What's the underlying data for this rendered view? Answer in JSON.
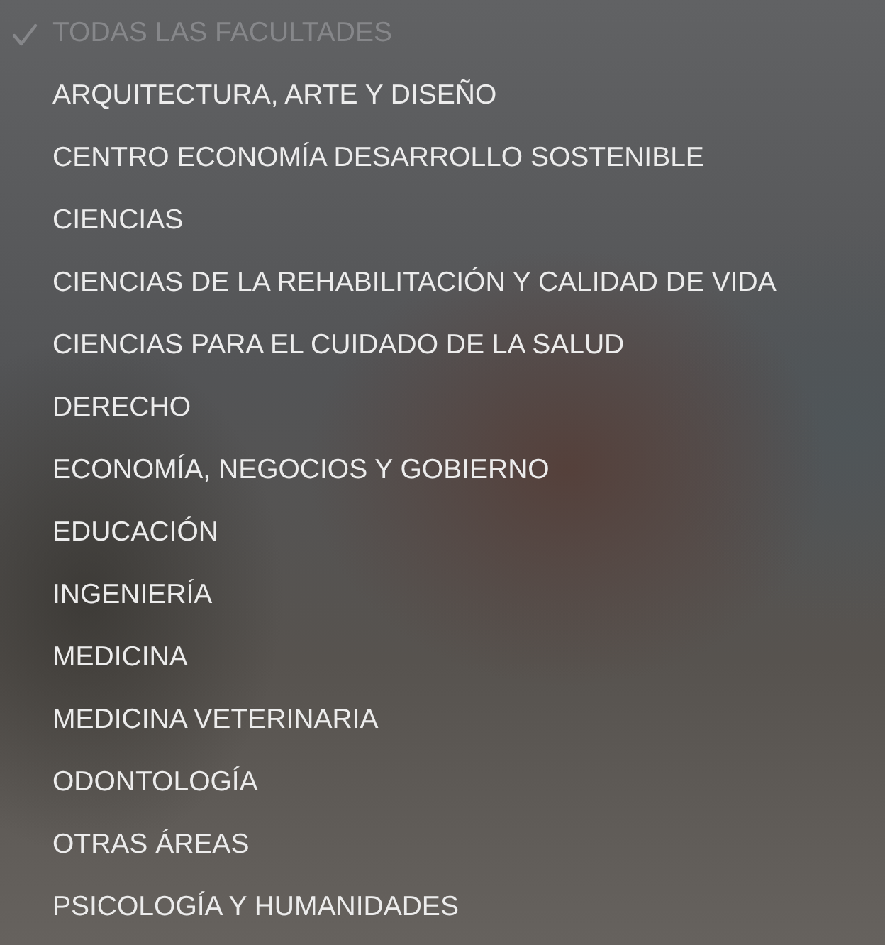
{
  "menu": {
    "items": [
      {
        "label": "TODAS LAS FACULTADES",
        "selected": true,
        "disabled": true
      },
      {
        "label": "ARQUITECTURA, ARTE Y DISEÑO",
        "selected": false,
        "disabled": false
      },
      {
        "label": "CENTRO ECONOMÍA DESARROLLO SOSTENIBLE",
        "selected": false,
        "disabled": false
      },
      {
        "label": "CIENCIAS",
        "selected": false,
        "disabled": false
      },
      {
        "label": "CIENCIAS DE LA REHABILITACIÓN Y CALIDAD DE VIDA",
        "selected": false,
        "disabled": false
      },
      {
        "label": "CIENCIAS PARA EL CUIDADO DE LA SALUD",
        "selected": false,
        "disabled": false
      },
      {
        "label": "DERECHO",
        "selected": false,
        "disabled": false
      },
      {
        "label": "ECONOMÍA, NEGOCIOS Y GOBIERNO",
        "selected": false,
        "disabled": false
      },
      {
        "label": "EDUCACIÓN",
        "selected": false,
        "disabled": false
      },
      {
        "label": "INGENIERÍA",
        "selected": false,
        "disabled": false
      },
      {
        "label": "MEDICINA",
        "selected": false,
        "disabled": false
      },
      {
        "label": "MEDICINA VETERINARIA",
        "selected": false,
        "disabled": false
      },
      {
        "label": "ODONTOLOGÍA",
        "selected": false,
        "disabled": false
      },
      {
        "label": "OTRAS ÁREAS",
        "selected": false,
        "disabled": false
      },
      {
        "label": "PSICOLOGÍA Y HUMANIDADES",
        "selected": false,
        "disabled": false
      }
    ]
  }
}
